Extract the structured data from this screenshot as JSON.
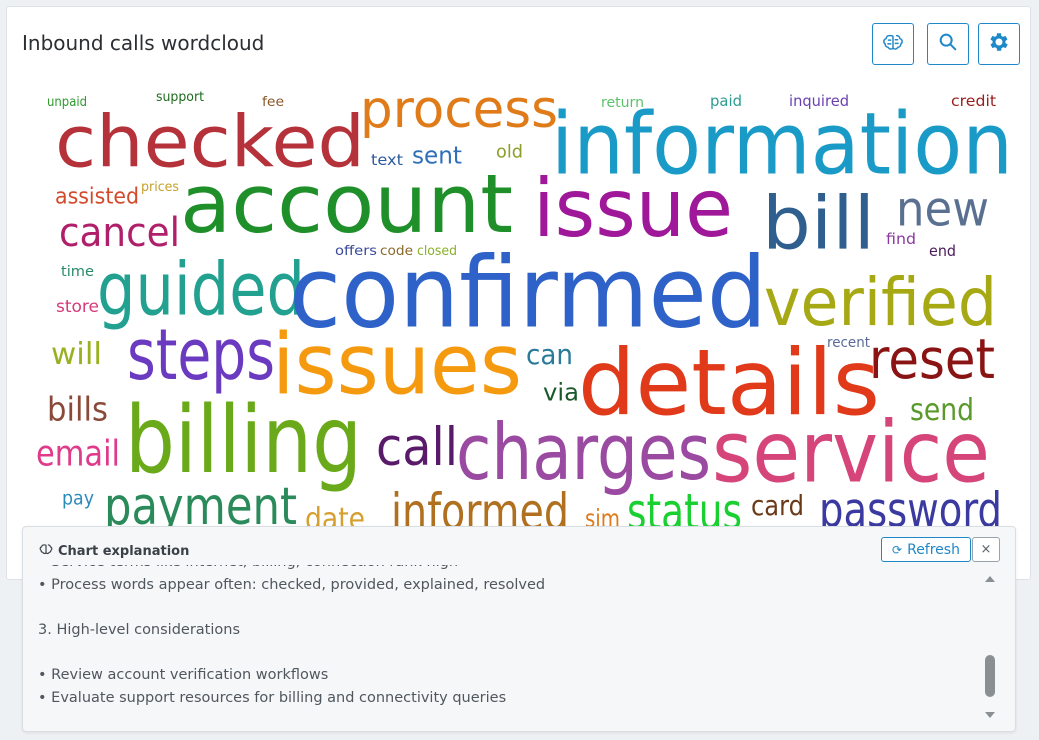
{
  "widget": {
    "title": "Inbound calls wordcloud",
    "toolbar": {
      "ai_icon": "brain-icon",
      "search_icon": "search-icon",
      "settings_icon": "gear-icon"
    }
  },
  "wordcloud": {
    "words": [
      {
        "text": "unpaid",
        "color": "#2e9a2e"
      },
      {
        "text": "support",
        "color": "#1f6b1f"
      },
      {
        "text": "fee",
        "color": "#8b5a2b"
      },
      {
        "text": "process",
        "color": "#e07b1a"
      },
      {
        "text": "return",
        "color": "#5cc26a"
      },
      {
        "text": "paid",
        "color": "#2a9d8f"
      },
      {
        "text": "inquired",
        "color": "#6a3fb0"
      },
      {
        "text": "credit",
        "color": "#9c1c1c"
      },
      {
        "text": "checked",
        "color": "#b5323a"
      },
      {
        "text": "information",
        "color": "#1a9bc7"
      },
      {
        "text": "text",
        "color": "#2c5aa0"
      },
      {
        "text": "sent",
        "color": "#2f6fb8"
      },
      {
        "text": "old",
        "color": "#8aa02a"
      },
      {
        "text": "assisted",
        "color": "#d24a2a"
      },
      {
        "text": "prices",
        "color": "#c4a22a"
      },
      {
        "text": "account",
        "color": "#1f8f2a"
      },
      {
        "text": "issue",
        "color": "#a0189a"
      },
      {
        "text": "bill",
        "color": "#2f5f8f"
      },
      {
        "text": "new",
        "color": "#5a7090"
      },
      {
        "text": "cancel",
        "color": "#b0206a"
      },
      {
        "text": "offers",
        "color": "#3a4a9a"
      },
      {
        "text": "code",
        "color": "#8a6a2a"
      },
      {
        "text": "closed",
        "color": "#8ab02a"
      },
      {
        "text": "find",
        "color": "#8a3aa0"
      },
      {
        "text": "end",
        "color": "#4a1a5a"
      },
      {
        "text": "time",
        "color": "#2a8a6a"
      },
      {
        "text": "guided",
        "color": "#22a090"
      },
      {
        "text": "confirmed",
        "color": "#2f62c9"
      },
      {
        "text": "verified",
        "color": "#a6a814"
      },
      {
        "text": "store",
        "color": "#d63a7a"
      },
      {
        "text": "will",
        "color": "#9ab020"
      },
      {
        "text": "steps",
        "color": "#6a3ac0"
      },
      {
        "text": "issues",
        "color": "#f59a0f"
      },
      {
        "text": "can",
        "color": "#2a7a9a"
      },
      {
        "text": "recent",
        "color": "#5a6a9a"
      },
      {
        "text": "reset",
        "color": "#8a1414"
      },
      {
        "text": "details",
        "color": "#e03a1a"
      },
      {
        "text": "via",
        "color": "#1a5a2a"
      },
      {
        "text": "bills",
        "color": "#8a4a3a"
      },
      {
        "text": "send",
        "color": "#5a9a2a"
      },
      {
        "text": "billing",
        "color": "#6aaa1a"
      },
      {
        "text": "email",
        "color": "#e03a8a"
      },
      {
        "text": "call",
        "color": "#5a1a6a"
      },
      {
        "text": "charges",
        "color": "#9a4aa0"
      },
      {
        "text": "service",
        "color": "#d6457a"
      },
      {
        "text": "pay",
        "color": "#2a8aba"
      },
      {
        "text": "payment",
        "color": "#2a8a5a"
      },
      {
        "text": "date",
        "color": "#d6a030"
      },
      {
        "text": "informed",
        "color": "#b07020"
      },
      {
        "text": "sim",
        "color": "#e07a1a"
      },
      {
        "text": "status",
        "color": "#1ad030"
      },
      {
        "text": "card",
        "color": "#6a3a1a"
      },
      {
        "text": "password",
        "color": "#3a3aa0"
      }
    ]
  },
  "explanation": {
    "icon": "brain-icon",
    "title": "Chart explanation",
    "refresh_label": "Refresh",
    "refresh_icon": "refresh-icon",
    "close_label": "×",
    "lines": [
      "• Service terms like internet, billing, connection rank high",
      "• Process words appear often: checked, provided, explained, resolved",
      "",
      "3. High-level considerations",
      "",
      "• Review account verification workflows",
      "• Evaluate support resources for billing and connectivity queries"
    ]
  }
}
